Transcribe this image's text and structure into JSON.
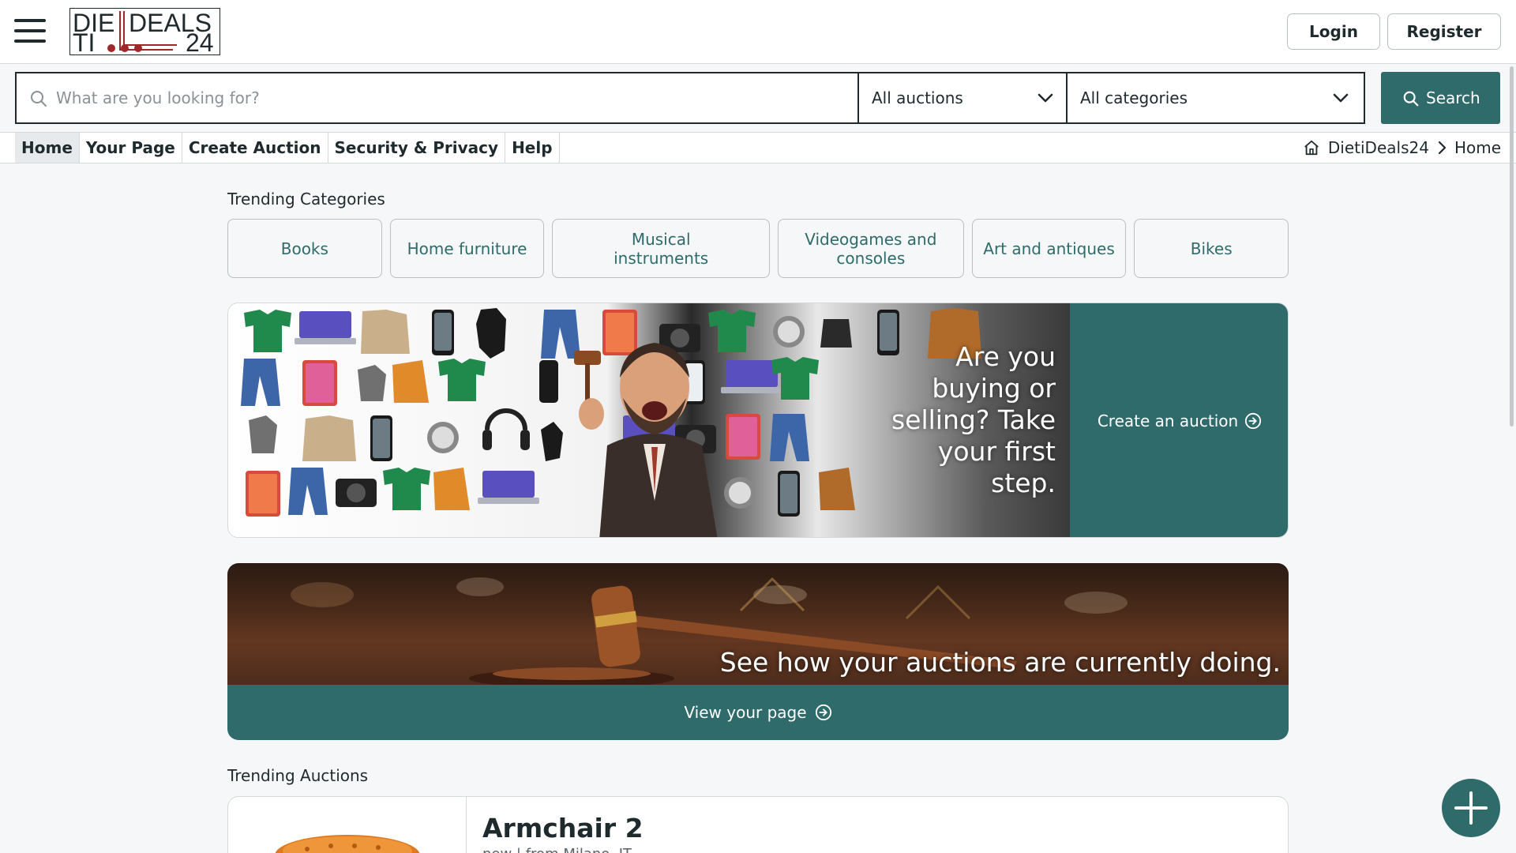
{
  "header": {
    "logo_text": "DIETIDEALS24",
    "login_label": "Login",
    "register_label": "Register"
  },
  "search": {
    "placeholder": "What are you looking for?",
    "auction_filter": "All auctions",
    "category_filter": "All categories",
    "button_label": "Search"
  },
  "nav": {
    "items": [
      {
        "label": "Home",
        "active": true
      },
      {
        "label": "Your Page",
        "active": false
      },
      {
        "label": "Create Auction",
        "active": false
      },
      {
        "label": "Security & Privacy",
        "active": false
      },
      {
        "label": "Help",
        "active": false
      }
    ]
  },
  "breadcrumb": {
    "root": "DietiDeals24",
    "current": "Home"
  },
  "trending_categories": {
    "title": "Trending Categories",
    "items": [
      "Books",
      "Home furniture",
      "Musical instruments",
      "Videogames and consoles",
      "Art and antiques",
      "Bikes"
    ]
  },
  "promo": {
    "text": "Are you buying or selling? Take your first step.",
    "action_label": "Create an auction"
  },
  "stats_banner": {
    "text": "See how your auctions are currently doing.",
    "action_label": "View your page"
  },
  "trending_auctions": {
    "title": "Trending Auctions",
    "first": {
      "title": "Armchair 2",
      "meta": "new | from Milano, IT"
    }
  },
  "colors": {
    "accent": "#2f6b6b",
    "text": "#1e2a2e",
    "background": "#f5f7f8"
  },
  "icons": [
    "menu-icon",
    "search-icon",
    "chevron-down-icon",
    "home-icon",
    "chevron-right-icon",
    "arrow-right-circle-icon",
    "plus-icon"
  ]
}
